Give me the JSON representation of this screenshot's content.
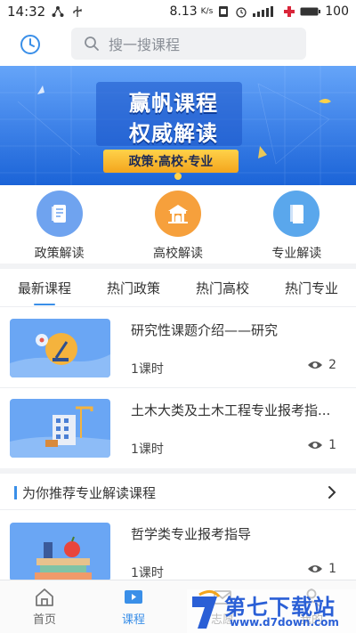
{
  "status_bar": {
    "time": "14:32",
    "net_speed": "8.13",
    "net_unit": "K/s",
    "battery": "100"
  },
  "search": {
    "placeholder": "搜一搜课程"
  },
  "banner": {
    "title_line1": "赢帆课程",
    "title_line2": "权威解读",
    "tagline": "政策·高校·专业"
  },
  "quick_links": [
    {
      "label": "政策解读",
      "icon": "policy-icon",
      "color": "#6fa3ef"
    },
    {
      "label": "高校解读",
      "icon": "university-icon",
      "color": "#f6a03c"
    },
    {
      "label": "专业解读",
      "icon": "book-icon",
      "color": "#5aa7ec"
    }
  ],
  "tabs": [
    {
      "label": "最新课程",
      "active": true
    },
    {
      "label": "热门政策",
      "active": false
    },
    {
      "label": "热门高校",
      "active": false
    },
    {
      "label": "热门专业",
      "active": false
    }
  ],
  "courses": [
    {
      "title": "研究性课题介绍——研究",
      "hours": "1课时",
      "views": "2"
    },
    {
      "title": "土木大类及土木工程专业报考指...",
      "hours": "1课时",
      "views": "1"
    }
  ],
  "recommend": {
    "title": "为你推荐专业解读课程",
    "courses": [
      {
        "title": "哲学类专业报考指导",
        "hours": "1课时",
        "views": "1"
      }
    ]
  },
  "bottom_nav": [
    {
      "label": "首页",
      "icon": "home-icon",
      "active": false
    },
    {
      "label": "课程",
      "icon": "play-icon",
      "active": true
    },
    {
      "label": "志愿",
      "icon": "mail-icon",
      "active": false
    },
    {
      "label": "我的",
      "icon": "user-icon",
      "active": false
    }
  ],
  "watermark": {
    "main": "第七下载站",
    "sub": "www.d7down.com"
  },
  "colors": {
    "accent": "#3a8fe8",
    "banner": "#2f7ef0"
  }
}
